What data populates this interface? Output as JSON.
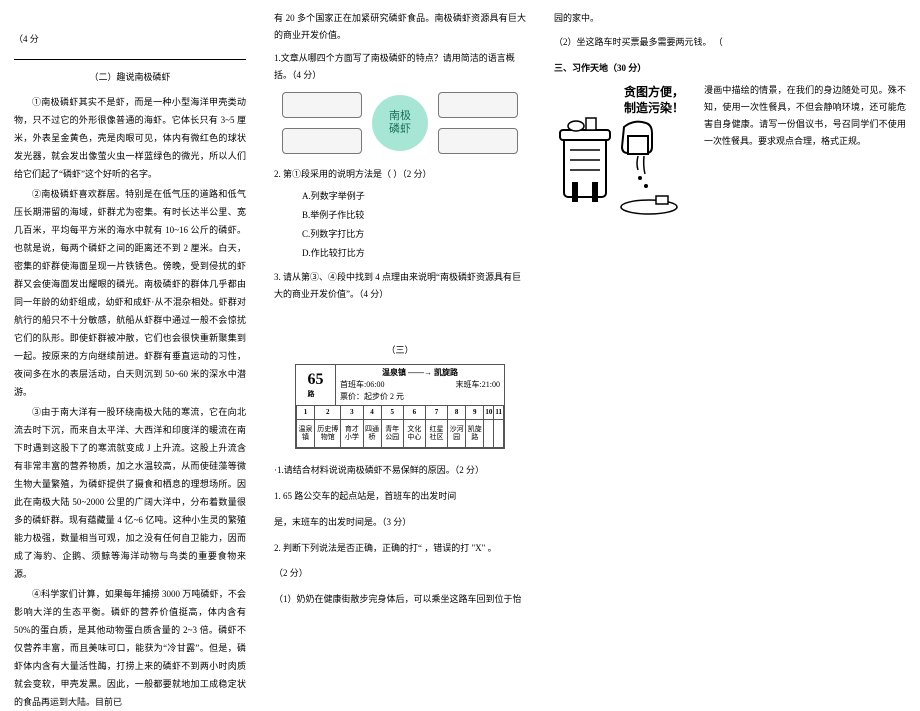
{
  "col1": {
    "score_top": "（4 分",
    "title": "（二）趣说南极磷虾",
    "p1": "①南极磷虾其实不是虾，而是一种小型海洋甲壳类动物，只不过它的外形很像普通的海虾。它体长只有 3~5 厘米，外表呈金黄色，壳是肉眼可见，体内有微红色的球状发光器，就会发出像萤火虫一样蓝绿色的微光，所以人们给它们起了“磷虾”这个好听的名字。",
    "p2": "②南极磷虾喜欢群居。特别是在低气压的道路和低气压长期滞留的海域，虾群尤为密集。有时长达半公里、宽几百米，平均每平方米的海水中就有 10~16 公斤的磷虾。也就是说，每两个磷虾之间的距离还不到 2 厘米。白天，密集的虾群使海面呈现一片铁锈色。傍晚，受到侵扰的虾群又会使海面发出耀眼的磷光。南极磷虾的群体几乎都由同一年龄的幼虾组成，幼虾和成虾·从不混杂相处。虾群对航行的船只不十分敏感，航船从虾群中通过一般不会惊扰它们的队形。即使虾群被冲散，它们也会很快重新聚集到一起。按原来的方向继续前进。虾群有垂直运动的习性，夜间多在水的表层活动，白天则沉到 50~60 米的深水中潜游。",
    "p3": "③由于南大洋有一股环绕南极大陆的寒流，它在向北流去时下沉，而来自太平洋、大西洋和印度洋的暖流在南下时遇到这股下了的寒流就变成 J 上升流。这股上升流含有非常丰富的营养物质，加之水温较高，从而使硅藻等微生物大量繁殖，为磷虾提供了摄食和栖息的理想场所。因此在南极大陆 50~2000 公里的广阔大洋中，分布着数量很多的磷虾群。现有蕴藏量 4 亿~6 亿吨。这种小生灵的繁殖能力极强，数量相当可观，加之没有任何自卫能力，因而成了海豹、企鹅、须鲸等海洋动物与鸟类的重要食物来源。",
    "p4": "④科学家们计算，如果每年捕捞 3000 万吨磷虾，不会影响大洋的生态平衡。磷虾的营养价值挺高，体内含有 50%的蛋白质，是其他动物蛋白质含量的 2~3 倍。磷虾不仅营养丰富，而且美味可口，能获为“冷甘露”。但是，磷虾体内含有大量活性酶，打捞上来的磷虾不到两小时肉质就会变软，甲壳发黑。因此，一般都要就地加工成稳定状的食品再运到大陆。目前已"
  },
  "col2": {
    "topline": "有 20 多个国家正在加紧研究磷虾食品。南极磷虾资源具有巨大的商业开发价值。",
    "q1": "1.文章从哪四个方面写了南极磷虾的特点？请用简洁的语言概括。（4 分）",
    "oval": "南极\n磷虾",
    "q2": "2. 第①段采用的说明方法是（          ）（2 分）",
    "optA": "A.列数字举例子",
    "optB": "B.举例子作比较",
    "optC": "C.列数字打比方",
    "optD": "D.作比较打比方",
    "q3": "3. 请从第③、④段中找到 4 点理由来说明“南极磷虾资源具有巨大的商业开发价值”。（4 分）",
    "sec3title": "（三）",
    "table": {
      "route_no": "65",
      "route_name": "温泉镇 → 凯旋路",
      "arrow": "温泉镇 ——→ 凯旋路",
      "first": "首班车:06:00",
      "last": "末班车:21:00",
      "fare_label": "路",
      "fare": "票价：起步价 2 元",
      "nums": [
        "1",
        "2",
        "3",
        "4",
        "5",
        "6",
        "7",
        "8",
        "9",
        "10",
        "11"
      ],
      "stops": [
        "温泉镇",
        "历史博物馆",
        "育才小学",
        "四通桥",
        "青年公园",
        "文化中心",
        "红星社区",
        "沙河园",
        "凯旋路",
        "",
        ""
      ]
    },
    "q3_1_star": "·1.请结合材料说说南极磷虾不易保鲜的原因。（2 分）",
    "q3_1": "1. 65 路公交车的起点站是，首班车的出发时间",
    "q3_1b": "是，末班车的出发时间是。（3 分）",
    "q3_2": "2. 判断下列说法是否正确，正确的打“          ，错误的打 \"X\" 。",
    "q3_2pts": "（2 分）",
    "q3_2a": "（1）奶奶在健康街散步完身体后，可以乘坐这路车回到位于怡"
  },
  "col3": {
    "cont": "园的家中。",
    "q2b": "（2）坐这路车时买票最多需要两元钱。                                                 （",
    "heading": "三、习作天地（30 分）",
    "caption_a": "贪图方便，",
    "caption_b": "制造污染！",
    "essay": "漫画中描绘的情景，在我们的身边随处可见。殊不知，使用一次性餐具，不但会静响环境，还可能危害自身健康。请写一份倡议书，号召同学们不使用一次性餐具。要求观点合理，格式正规。"
  }
}
